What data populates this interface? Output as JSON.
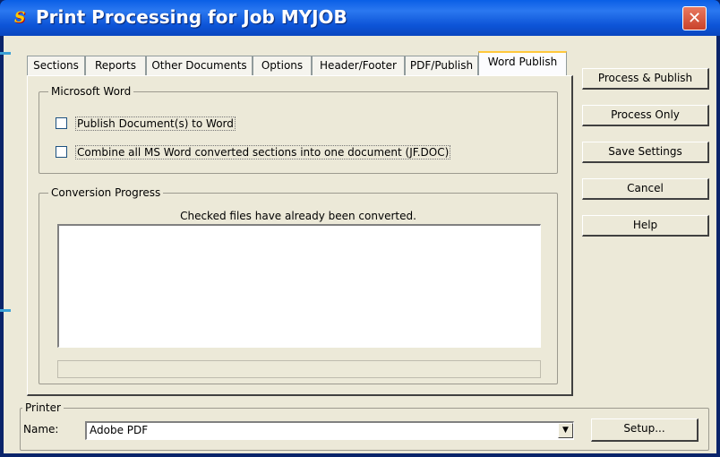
{
  "window": {
    "title": "Print Processing for Job MYJOB",
    "app_icon": "SJ",
    "close_symbol": "✕"
  },
  "tabs": [
    {
      "label": "Sections",
      "active": false
    },
    {
      "label": "Reports",
      "active": false
    },
    {
      "label": "Other Documents",
      "active": false
    },
    {
      "label": "Options",
      "active": false
    },
    {
      "label": "Header/Footer",
      "active": false
    },
    {
      "label": "PDF/Publish",
      "active": false
    },
    {
      "label": "Word Publish",
      "active": true
    }
  ],
  "word_group": {
    "label": "Microsoft Word",
    "options": [
      {
        "label": "Publish Document(s) to Word",
        "checked": false
      },
      {
        "label": "Combine all MS Word converted sections into one document (JF.DOC)",
        "checked": false
      }
    ]
  },
  "progress_group": {
    "label": "Conversion Progress",
    "info": "Checked files have already been converted.",
    "progress_percent": 0
  },
  "buttons": {
    "process_publish": "Process & Publish",
    "process_only": "Process Only",
    "save_settings": "Save Settings",
    "cancel": "Cancel",
    "help": "Help"
  },
  "printer": {
    "group_label": "Printer",
    "name_label": "Name:",
    "selected": "Adobe PDF",
    "setup_label": "Setup..."
  },
  "colors": {
    "titlebar": "#0a5fe6",
    "face": "#ece9d8",
    "close": "#c9422b",
    "active_tab_accent": "#ffc83c"
  }
}
